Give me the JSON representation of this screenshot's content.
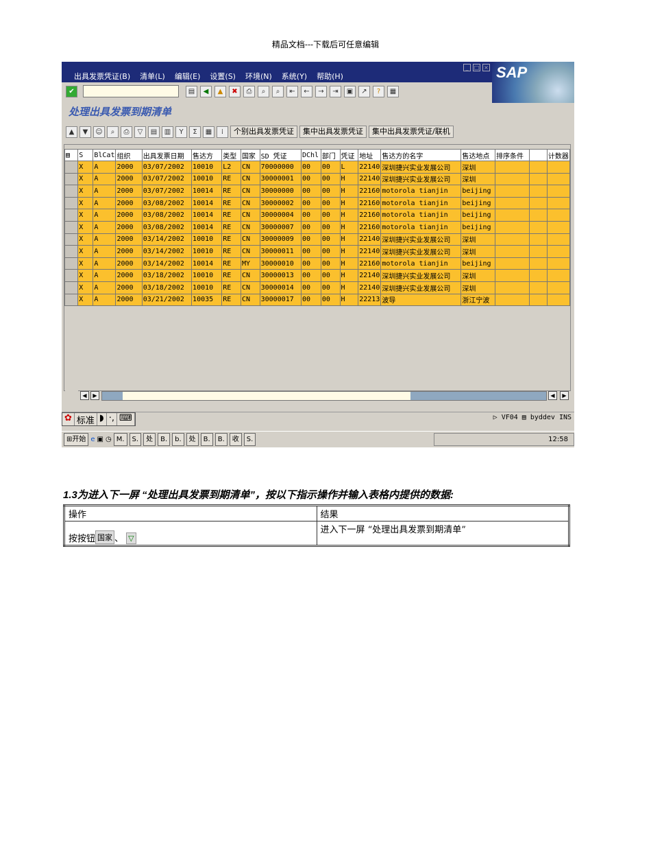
{
  "header": "精品文档---下载后可任意编辑",
  "sap": {
    "logo": "SAP",
    "menu": [
      "出具发票凭证(B)",
      "清单(L)",
      "编辑(E)",
      "设置(S)",
      "环境(N)",
      "系统(Y)",
      "帮助(H)"
    ],
    "command_value": "",
    "page_title": "处理出具发票到期清单",
    "app_buttons": [
      "个别出具发票凭证",
      "集中出具发票凭证",
      "集中出具发票凭证/联机"
    ],
    "columns": [
      "S",
      "BlCat",
      "组织",
      "出具发票日期",
      "售达方",
      "类型",
      "国家",
      "SD 凭证",
      "DChl",
      "部门",
      "凭证",
      "地址",
      "售达方的名字",
      "售达地点",
      "排序条件",
      "",
      "计数器"
    ],
    "rows": [
      [
        "X",
        "A",
        "2000",
        "03/07/2002",
        "10010",
        "L2",
        "CN",
        "70000000",
        "00",
        "00",
        "L",
        "22140",
        "深圳捷兴实业发展公司",
        "深圳",
        "",
        "",
        ""
      ],
      [
        "X",
        "A",
        "2000",
        "03/07/2002",
        "10010",
        "RE",
        "CN",
        "30000001",
        "00",
        "00",
        "H",
        "22140",
        "深圳捷兴实业发展公司",
        "深圳",
        "",
        "",
        ""
      ],
      [
        "X",
        "A",
        "2000",
        "03/07/2002",
        "10014",
        "RE",
        "CN",
        "30000000",
        "00",
        "00",
        "H",
        "22160",
        "motorola tianjin",
        "beijing",
        "",
        "",
        ""
      ],
      [
        "X",
        "A",
        "2000",
        "03/08/2002",
        "10014",
        "RE",
        "CN",
        "30000002",
        "00",
        "00",
        "H",
        "22160",
        "motorola tianjin",
        "beijing",
        "",
        "",
        ""
      ],
      [
        "X",
        "A",
        "2000",
        "03/08/2002",
        "10014",
        "RE",
        "CN",
        "30000004",
        "00",
        "00",
        "H",
        "22160",
        "motorola tianjin",
        "beijing",
        "",
        "",
        ""
      ],
      [
        "X",
        "A",
        "2000",
        "03/08/2002",
        "10014",
        "RE",
        "CN",
        "30000007",
        "00",
        "00",
        "H",
        "22160",
        "motorola tianjin",
        "beijing",
        "",
        "",
        ""
      ],
      [
        "X",
        "A",
        "2000",
        "03/14/2002",
        "10010",
        "RE",
        "CN",
        "30000009",
        "00",
        "00",
        "H",
        "22140",
        "深圳捷兴实业发展公司",
        "深圳",
        "",
        "",
        ""
      ],
      [
        "X",
        "A",
        "2000",
        "03/14/2002",
        "10010",
        "RE",
        "CN",
        "30000011",
        "00",
        "00",
        "H",
        "22140",
        "深圳捷兴实业发展公司",
        "深圳",
        "",
        "",
        ""
      ],
      [
        "X",
        "A",
        "2000",
        "03/14/2002",
        "10014",
        "RE",
        "MY",
        "30000010",
        "00",
        "00",
        "H",
        "22160",
        "motorola tianjin",
        "beijing",
        "",
        "",
        ""
      ],
      [
        "X",
        "A",
        "2000",
        "03/18/2002",
        "10010",
        "RE",
        "CN",
        "30000013",
        "00",
        "00",
        "H",
        "22140",
        "深圳捷兴实业发展公司",
        "深圳",
        "",
        "",
        ""
      ],
      [
        "X",
        "A",
        "2000",
        "03/18/2002",
        "10010",
        "RE",
        "CN",
        "30000014",
        "00",
        "00",
        "H",
        "22140",
        "深圳捷兴实业发展公司",
        "深圳",
        "",
        "",
        ""
      ],
      [
        "X",
        "A",
        "2000",
        "03/21/2002",
        "10035",
        "RE",
        "CN",
        "30000017",
        "00",
        "00",
        "H",
        "22213",
        "波导",
        "浙江宁波",
        "",
        "",
        ""
      ]
    ],
    "ime": [
      "标准",
      "·,"
    ],
    "status": {
      "tcode": "VF04",
      "server": "byddev",
      "mode": "INS"
    },
    "taskbar": {
      "start": "开始",
      "items": [
        "M.",
        "S.",
        "处",
        "B.",
        "b.",
        "处",
        "B.",
        "B.",
        "收",
        "S."
      ],
      "clock": "12:58"
    }
  },
  "doc": {
    "heading": "1.3为进入下一屏 “处理出具发票到期清单”，按以下指示操作并输入表格内提供的数据:",
    "table": {
      "h1": "操作",
      "h2": "结果",
      "op_prefix": "按按钮",
      "btn_label": "国家",
      "sep": "、",
      "result": "进入下一屏 “处理出具发票到期清单”"
    }
  }
}
